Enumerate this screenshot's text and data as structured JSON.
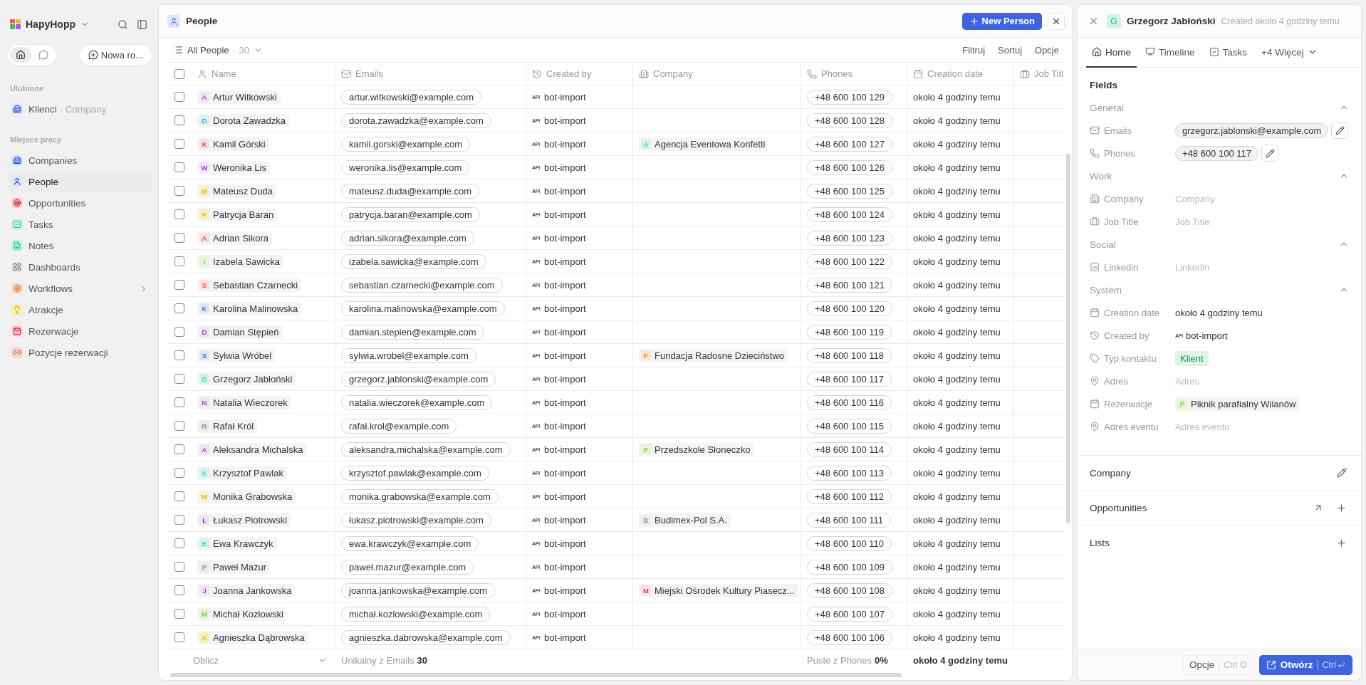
{
  "sidebar": {
    "workspace": "HapyHopp",
    "toggles": [
      {
        "kind": "home",
        "selected": true
      },
      {
        "kind": "chat",
        "selected": false
      }
    ],
    "new_chat": "Nowa ro...",
    "favorites_title": "Ulubione",
    "favorites": [
      {
        "kind": "company-list",
        "label": "Klienci",
        "sub": "· Company",
        "color": "#dde6fb"
      }
    ],
    "workspace_title": "Miejsce pracy",
    "items": [
      {
        "kind": "companies",
        "label": "Companies",
        "color": "#dde6fb",
        "selected": false,
        "expandable": false
      },
      {
        "kind": "people",
        "label": "People",
        "color": "#dde6fb",
        "selected": true,
        "expandable": false
      },
      {
        "kind": "opportunities",
        "label": "Opportunities",
        "color": "#fbd9d9",
        "selected": false,
        "expandable": false
      },
      {
        "kind": "tasks",
        "label": "Tasks",
        "color": "#cdf0e3",
        "selected": false,
        "expandable": false
      },
      {
        "kind": "notes",
        "label": "Notes",
        "color": "#cdf0e3",
        "selected": false,
        "expandable": false
      },
      {
        "kind": "dashboards",
        "label": "Dashboards",
        "color": "#e6e6e6",
        "selected": false,
        "expandable": false
      },
      {
        "kind": "workflows",
        "label": "Workflows",
        "color": "#fddcc4",
        "selected": false,
        "expandable": true
      },
      {
        "kind": "attractions",
        "label": "Atrakcje",
        "color": "#fbefb0",
        "selected": false,
        "expandable": false
      },
      {
        "kind": "bookings",
        "label": "Rezerwacje",
        "color": "#fbd8dd",
        "selected": false,
        "expandable": false
      },
      {
        "kind": "booking-items",
        "label": "Pozycje rezerwacji",
        "color": "#ecdcd5",
        "selected": false,
        "expandable": false
      }
    ]
  },
  "view": {
    "title": "People",
    "new_button": "New Person",
    "view_name": "All People",
    "count": "· 30",
    "actions": [
      "Filtruj",
      "Sortuj",
      "Opcje"
    ]
  },
  "table": {
    "all_checked": false,
    "columns": [
      {
        "kind": "name",
        "label": "Name"
      },
      {
        "kind": "email",
        "label": "Emails"
      },
      {
        "kind": "created_by",
        "label": "Created by"
      },
      {
        "kind": "company",
        "label": "Company"
      },
      {
        "kind": "phone",
        "label": "Phones"
      },
      {
        "kind": "date",
        "label": "Creation date"
      },
      {
        "kind": "job",
        "label": "Job Titl"
      }
    ],
    "rows": [
      {
        "checked": false,
        "initial": "A",
        "color": "#f1e2fb",
        "name": "Artur Witkowski",
        "email": "artur.witkowski@example.com",
        "source": "API",
        "created_by": "bot-import",
        "phone": "+48 600 100 129",
        "created": "około 4 godziny temu"
      },
      {
        "checked": false,
        "initial": "D",
        "color": "#dbeff8",
        "name": "Dorota Zawadzka",
        "email": "dorota.zawadzka@example.com",
        "source": "API",
        "created_by": "bot-import",
        "phone": "+48 600 100 128",
        "created": "około 4 godziny temu"
      },
      {
        "checked": false,
        "initial": "K",
        "color": "#fbe0e0",
        "name": "Kamil Górski",
        "email": "kamil.gorski@example.com",
        "source": "API",
        "created_by": "bot-import",
        "company": {
          "initial": "A",
          "color": "#d5f2e6",
          "name": "Agencja Eventowa Konfetti"
        },
        "phone": "+48 600 100 127",
        "created": "około 4 godziny temu"
      },
      {
        "checked": false,
        "initial": "W",
        "color": "#eee3fb",
        "name": "Weronika Lis",
        "email": "weronika.lis@example.com",
        "source": "API",
        "created_by": "bot-import",
        "phone": "+48 600 100 126",
        "created": "około 4 godziny temu"
      },
      {
        "checked": false,
        "initial": "M",
        "color": "#fbf0c4",
        "name": "Mateusz Duda",
        "email": "mateusz.duda@example.com",
        "source": "API",
        "created_by": "bot-import",
        "phone": "+48 600 100 125",
        "created": "około 4 godziny temu"
      },
      {
        "checked": false,
        "initial": "P",
        "color": "#fbefc0",
        "name": "Patrycja Baran",
        "email": "patrycja.baran@example.com",
        "source": "API",
        "created_by": "bot-import",
        "phone": "+48 600 100 124",
        "created": "około 4 godziny temu"
      },
      {
        "checked": false,
        "initial": "A",
        "color": "#fbe0e0",
        "name": "Adrian Sikora",
        "email": "adrian.sikora@example.com",
        "source": "API",
        "created_by": "bot-import",
        "phone": "+48 600 100 123",
        "created": "około 4 godziny temu"
      },
      {
        "checked": false,
        "initial": "I",
        "color": "#e3f4d9",
        "name": "Izabela Sawicka",
        "email": "izabela.sawicka@example.com",
        "source": "API",
        "created_by": "bot-import",
        "phone": "+48 600 100 122",
        "created": "około 4 godziny temu"
      },
      {
        "checked": false,
        "initial": "S",
        "color": "#fbe1dc",
        "name": "Sebastian Czarnecki",
        "email": "sebastian.czarnecki@example.com",
        "source": "API",
        "created_by": "bot-import",
        "phone": "+48 600 100 121",
        "created": "około 4 godziny temu"
      },
      {
        "checked": false,
        "initial": "K",
        "color": "#dde6fb",
        "name": "Karolina Malinowska",
        "email": "karolina.malinowska@example.com",
        "source": "API",
        "created_by": "bot-import",
        "phone": "+48 600 100 120",
        "created": "około 4 godziny temu"
      },
      {
        "checked": false,
        "initial": "D",
        "color": "#eee3fb",
        "name": "Damian Stępień",
        "email": "damian.stepien@example.com",
        "source": "API",
        "created_by": "bot-import",
        "phone": "+48 600 100 119",
        "created": "około 4 godziny temu"
      },
      {
        "checked": false,
        "initial": "S",
        "color": "#dde6fb",
        "name": "Sylwia Wróbel",
        "email": "sylwia.wrobel@example.com",
        "source": "API",
        "created_by": "bot-import",
        "company": {
          "initial": "F",
          "color": "#fde3cc",
          "name": "Fundacja Radosne Dzieciństwo"
        },
        "phone": "+48 600 100 118",
        "created": "około 4 godziny temu"
      },
      {
        "checked": false,
        "initial": "G",
        "color": "#d5f2e6",
        "name": "Grzegorz Jabłoński",
        "email": "grzegorz.jablonski@example.com",
        "source": "API",
        "created_by": "bot-import",
        "phone": "+48 600 100 117",
        "created": "około 4 godziny temu"
      },
      {
        "checked": false,
        "initial": "N",
        "color": "#eee3fb",
        "name": "Natalia Wieczorek",
        "email": "natalia.wieczorek@example.com",
        "source": "API",
        "created_by": "bot-import",
        "phone": "+48 600 100 116",
        "created": "około 4 godziny temu"
      },
      {
        "checked": false,
        "initial": "R",
        "color": "#ebebeb",
        "name": "Rafał Król",
        "email": "rafał.krol@example.com",
        "source": "API",
        "created_by": "bot-import",
        "phone": "+48 600 100 115",
        "created": "około 4 godziny temu"
      },
      {
        "checked": false,
        "initial": "A",
        "color": "#f1e2fb",
        "name": "Aleksandra Michalska",
        "email": "aleksandra.michalska@example.com",
        "source": "API",
        "created_by": "bot-import",
        "company": {
          "initial": "P",
          "color": "#e3f4d9",
          "name": "Przedszkole Słoneczko"
        },
        "phone": "+48 600 100 114",
        "created": "około 4 godziny temu"
      },
      {
        "checked": false,
        "initial": "K",
        "color": "#d5f0ef",
        "name": "Krzysztof Pawlak",
        "email": "krzysztof.pawlak@example.com",
        "source": "API",
        "created_by": "bot-import",
        "phone": "+48 600 100 113",
        "created": "około 4 godziny temu"
      },
      {
        "checked": false,
        "initial": "M",
        "color": "#fbf0c4",
        "name": "Monika Grabowska",
        "email": "monika.grabowska@example.com",
        "source": "API",
        "created_by": "bot-import",
        "phone": "+48 600 100 112",
        "created": "około 4 godziny temu"
      },
      {
        "checked": false,
        "initial": "Ł",
        "color": "#eee3fb",
        "name": "Łukasz Piotrowski",
        "email": "łukasz.piotrowski@example.com",
        "source": "API",
        "created_by": "bot-import",
        "company": {
          "initial": "B",
          "color": "#ebebeb",
          "name": "Budimex-Pol S.A."
        },
        "phone": "+48 600 100 111",
        "created": "około 4 godziny temu"
      },
      {
        "checked": false,
        "initial": "E",
        "color": "#d5f0ef",
        "name": "Ewa Krawczyk",
        "email": "ewa.krawczyk@example.com",
        "source": "API",
        "created_by": "bot-import",
        "phone": "+48 600 100 110",
        "created": "około 4 godziny temu"
      },
      {
        "checked": false,
        "initial": "P",
        "color": "#ebebeb",
        "name": "Paweł Mazur",
        "email": "paweł.mazur@example.com",
        "source": "API",
        "created_by": "bot-import",
        "phone": "+48 600 100 109",
        "created": "około 4 godziny temu"
      },
      {
        "checked": false,
        "initial": "J",
        "color": "#f1e2fb",
        "name": "Joanna Jankowska",
        "email": "joanna.jankowska@example.com",
        "source": "API",
        "created_by": "bot-import",
        "company": {
          "initial": "M",
          "color": "#fbdfe3",
          "name": "Miejski Ośrodek Kultury Piasecz..."
        },
        "phone": "+48 600 100 108",
        "created": "około 4 godziny temu"
      },
      {
        "checked": false,
        "initial": "M",
        "color": "#e3f4d9",
        "name": "Michał Kozłowski",
        "email": "michał.kozlowski@example.com",
        "source": "API",
        "created_by": "bot-import",
        "phone": "+48 600 100 107",
        "created": "około 4 godziny temu"
      },
      {
        "checked": false,
        "initial": "A",
        "color": "#fbefb0",
        "name": "Agnieszka Dąbrowska",
        "email": "agnieszka.dabrowska@example.com",
        "source": "API",
        "created_by": "bot-import",
        "phone": "+48 600 100 106",
        "created": "około 4 godziny temu"
      }
    ],
    "footer": {
      "calc": "Oblicz",
      "emails_label": "Unikalny z Emails",
      "emails_value": "30",
      "phones_label": "Puste z Phones",
      "phones_value": "0%",
      "date_value": "około 4 godziny temu"
    }
  },
  "record": {
    "initial": "G",
    "color": "#d5f2e6",
    "name": "Grzegorz Jabłoński",
    "created": "Created około 4 godziny temu",
    "tabs": [
      {
        "kind": "home",
        "label": "Home",
        "selected": true
      },
      {
        "kind": "timeline",
        "label": "Timeline",
        "selected": false
      },
      {
        "kind": "tasks",
        "label": "Tasks",
        "selected": false
      },
      {
        "kind": "more",
        "label": "+4 Więcej",
        "selected": false
      }
    ],
    "fields_title": "Fields",
    "groups": [
      {
        "title": "General",
        "expanded": true,
        "fields": [
          {
            "kind": "chip",
            "label": "Emails",
            "value": "grzegorz.jablonski@example.com"
          },
          {
            "kind": "chip",
            "label": "Phones",
            "value": "+48 600 100 117"
          }
        ]
      },
      {
        "title": "Work",
        "expanded": true,
        "fields": [
          {
            "kind": "empty",
            "label": "Company",
            "placeholder": "Company"
          },
          {
            "kind": "empty",
            "label": "Job Title",
            "placeholder": "Job Title"
          }
        ]
      },
      {
        "title": "Social",
        "expanded": true,
        "fields": [
          {
            "kind": "empty",
            "label": "Linkedin",
            "placeholder": "Linkedin"
          }
        ]
      },
      {
        "title": "System",
        "expanded": true,
        "fields": [
          {
            "kind": "text",
            "label": "Creation date",
            "value": "około 4 godziny temu"
          },
          {
            "kind": "api",
            "label": "Created by",
            "badge": "API",
            "value": "bot-import"
          },
          {
            "kind": "tag",
            "label": "Typ kontaktu",
            "value": "Klient",
            "color": "#ddf4e6"
          },
          {
            "kind": "empty",
            "label": "Adres",
            "placeholder": "Adres"
          },
          {
            "kind": "relation",
            "label": "Rezerwacje",
            "initial": "P",
            "color": "#e3f4d9",
            "value": "Piknik parafialny Wilanów"
          },
          {
            "kind": "empty",
            "label": "Adres eventu",
            "placeholder": "Adres eventu"
          }
        ]
      }
    ],
    "relations": [
      {
        "title": "Company",
        "editable": true,
        "openable": false,
        "addable": false
      },
      {
        "title": "Opportunities",
        "editable": false,
        "openable": true,
        "addable": true
      },
      {
        "title": "Lists",
        "editable": false,
        "openable": false,
        "addable": true
      }
    ],
    "footer": {
      "options": "Opcje",
      "options_key": "Ctrl O",
      "open": "Otwórz",
      "open_key": "Ctrl"
    }
  }
}
